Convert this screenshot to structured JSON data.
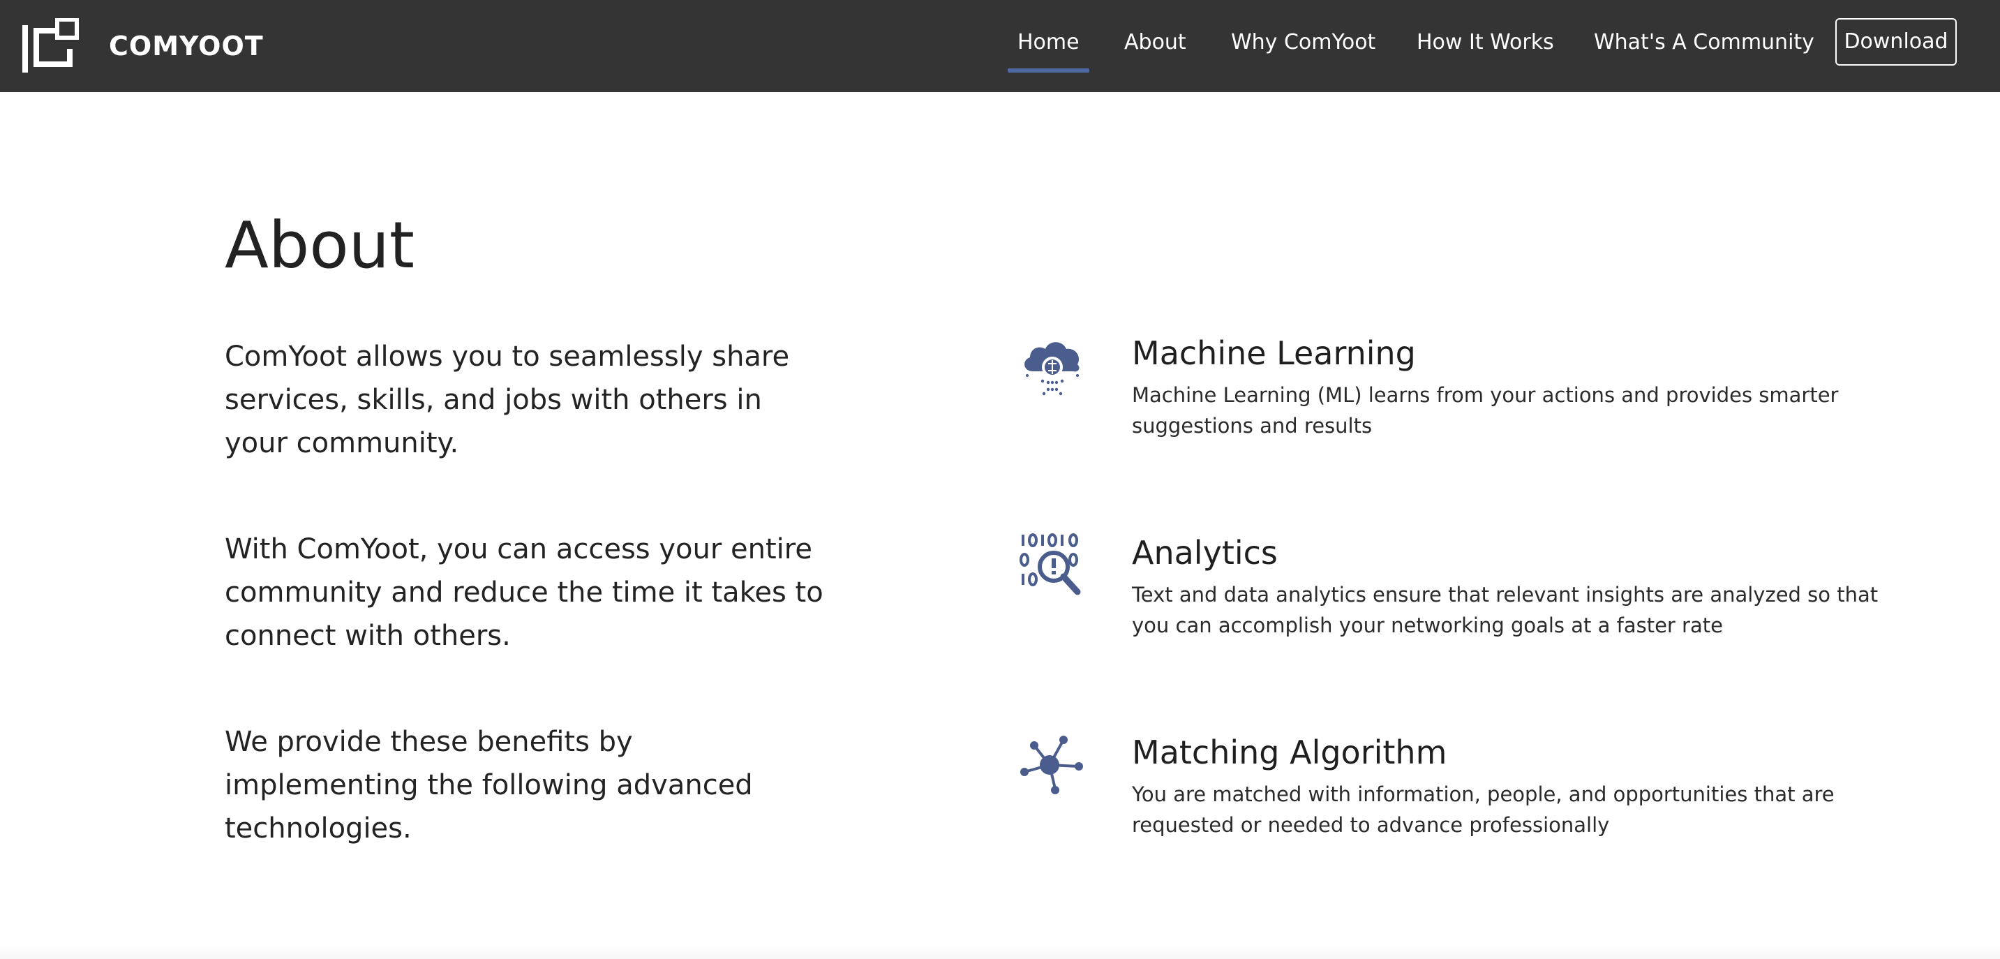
{
  "brand": {
    "name": "COMYOOT"
  },
  "nav": {
    "items": [
      {
        "label": "Home",
        "active": true
      },
      {
        "label": "About"
      },
      {
        "label": "Why ComYoot"
      },
      {
        "label": "How It Works"
      },
      {
        "label": "What's A Community"
      }
    ],
    "download_label": "Download"
  },
  "about": {
    "title": "About",
    "paragraphs": [
      "ComYoot allows you to seamlessly share services, skills, and jobs with others in your community.",
      "With ComYoot, you can access your entire community and reduce the time it takes to connect with others.",
      "We provide these benefits by implementing the following advanced technologies."
    ]
  },
  "features": [
    {
      "icon": "cloud-brain-icon",
      "title": "Machine Learning",
      "description": "Machine Learning (ML) learns from your actions and provides smarter suggestions and results"
    },
    {
      "icon": "binary-magnifier-icon",
      "title": "Analytics",
      "description": "Text and data analytics ensure that relevant insights are analyzed so that you can accomplish your networking goals at a faster rate"
    },
    {
      "icon": "network-hub-icon",
      "title": "Matching Algorithm",
      "description": "You are matched with information, people, and opportunities that are requested or needed to advance professionally"
    }
  ],
  "colors": {
    "navbar": "#343434",
    "accent": "#4f6aa2",
    "icon": "#4a5d8c",
    "text": "#1f1f1f"
  }
}
